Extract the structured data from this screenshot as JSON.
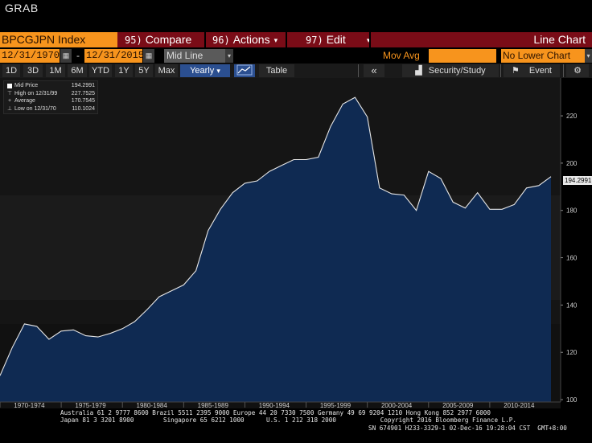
{
  "window": {
    "title": "GRAB"
  },
  "header": {
    "ticker": "BPCGJPN Index",
    "menus": [
      {
        "num": "95)",
        "label": "Compare"
      },
      {
        "num": "96)",
        "label": "Actions"
      },
      {
        "num": "97)",
        "label": "Edit"
      }
    ],
    "chart_type": "Line Chart"
  },
  "daterow": {
    "start": "12/31/1970",
    "end": "12/31/2015",
    "field": "Mid Line",
    "mov_avg_label": "Mov Avg",
    "mov_avg_value": "",
    "lower": "No Lower Chart"
  },
  "toolbar": {
    "periods": [
      "1D",
      "3D",
      "1M",
      "6M",
      "YTD",
      "1Y",
      "5Y",
      "Max"
    ],
    "frequency": "Yearly",
    "table": "Table",
    "security": "Security/Study",
    "event": "Event"
  },
  "legend": {
    "rows": [
      {
        "label": "Mid Price",
        "value": "194.2991"
      },
      {
        "label": "High on 12/31/99",
        "value": "227.7525"
      },
      {
        "label": "Average",
        "value": "170.7545"
      },
      {
        "label": "Low on 12/31/70",
        "value": "110.1024"
      }
    ]
  },
  "last_value": "194.2991",
  "footer": {
    "line1": "Australia 61 2 9777 8600 Brazil 5511 2395 9000 Europe 44 20 7330 7500 Germany 49 69 9204 1210 Hong Kong 852 2977 6000",
    "line2": "Japan 81 3 3201 8900        Singapore 65 6212 1000      U.S. 1 212 318 2000            Copyright 2016 Bloomberg Finance L.P.",
    "line3": "SN 674901 H233-3329-1 02-Dec-16 19:28:04 CST  GMT+8:00"
  },
  "colors": {
    "area_fill": "#0f2a52",
    "line": "#e6e6e6",
    "accent": "#f7941d",
    "menubar": "#7a0c17"
  },
  "chart_data": {
    "type": "area",
    "x": [
      1970,
      1971,
      1972,
      1973,
      1974,
      1975,
      1976,
      1977,
      1978,
      1979,
      1980,
      1981,
      1982,
      1983,
      1984,
      1985,
      1986,
      1987,
      1988,
      1989,
      1990,
      1991,
      1992,
      1993,
      1994,
      1995,
      1996,
      1997,
      1998,
      1999,
      2000,
      2001,
      2002,
      2003,
      2004,
      2005,
      2006,
      2007,
      2008,
      2009,
      2010,
      2011,
      2012,
      2013,
      2014,
      2015
    ],
    "series": [
      {
        "name": "Mid Price",
        "values": [
          110.1,
          122.0,
          132.0,
          131.0,
          125.5,
          129.0,
          129.5,
          127.0,
          126.5,
          128.0,
          130.0,
          133.0,
          138.0,
          143.5,
          146.0,
          148.5,
          154.5,
          171.5,
          180.5,
          187.5,
          191.5,
          192.5,
          196.5,
          199.0,
          201.5,
          201.5,
          202.5,
          215.5,
          225.0,
          227.8,
          219.5,
          189.5,
          187.0,
          186.5,
          180.0,
          196.5,
          193.5,
          183.5,
          181.0,
          187.5,
          180.5,
          180.5,
          182.5,
          189.5,
          190.5,
          194.3
        ]
      }
    ],
    "x_tick_labels": [
      "1970-1974",
      "1975-1979",
      "1980-1984",
      "1985-1989",
      "1990-1994",
      "1995-1999",
      "2000-2004",
      "2005-2009",
      "2010-2014"
    ],
    "y_ticks": [
      100,
      120,
      140,
      160,
      180,
      200,
      220
    ],
    "ylim": [
      99,
      236
    ],
    "grid": false,
    "legend_position": "top-left"
  }
}
